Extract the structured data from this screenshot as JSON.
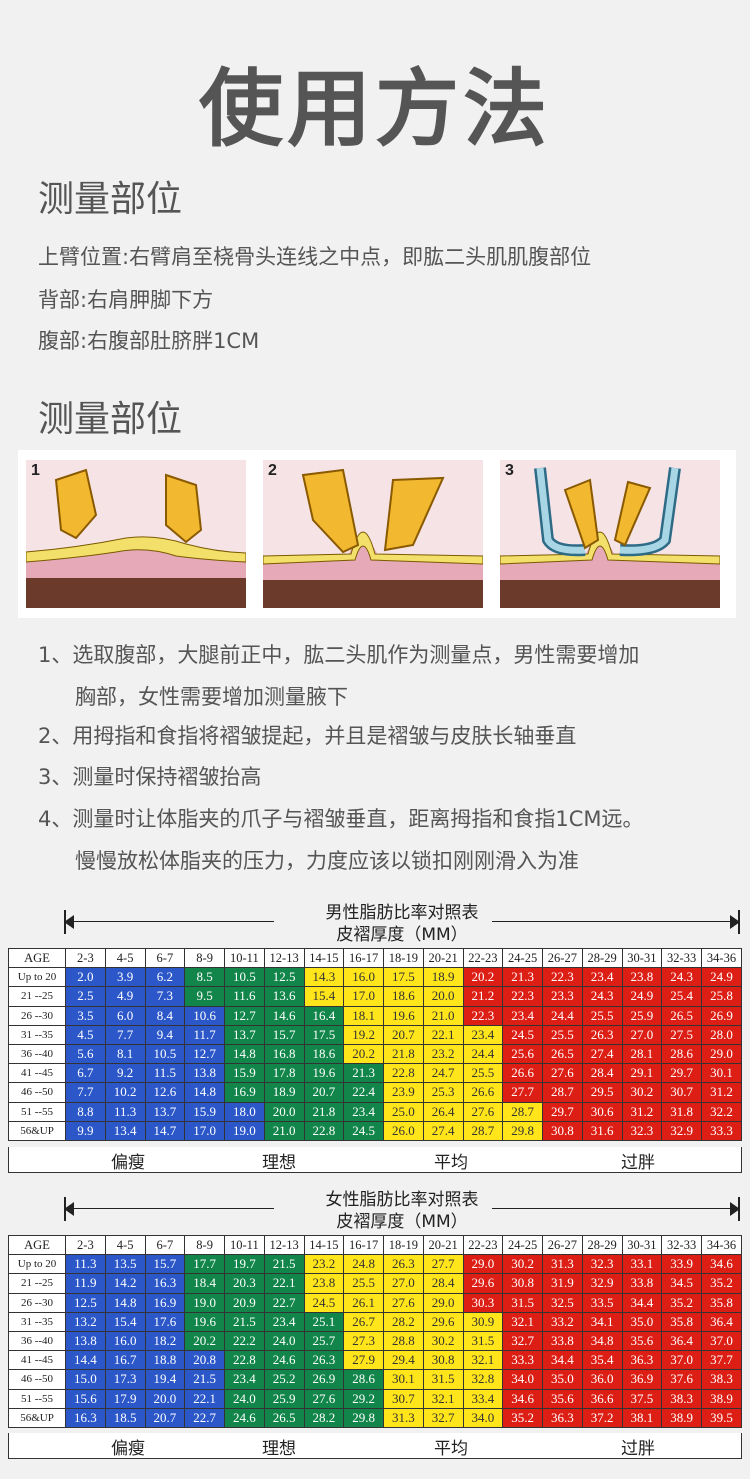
{
  "title": "使用方法",
  "section1": {
    "heading": "测量部位",
    "lines": [
      "上臂位置:右臂肩至桡骨头连线之中点，即肱二头肌肌腹部位",
      "背部:右肩胛脚下方",
      "腹部:右腹部肚脐胖1CM"
    ]
  },
  "section2": {
    "heading": "测量部位",
    "panels": [
      "1",
      "2",
      "3"
    ],
    "steps": [
      {
        "line1": "1、选取腹部，大腿前正中，肱二头肌作为测量点，男性需要增加",
        "line2": "胸部，女性需要增加测量腋下"
      },
      {
        "line1": "2、用拇指和食指将褶皱提起，并且是褶皱与皮肤长轴垂直",
        "line2": ""
      },
      {
        "line1": "3、测量时保持褶皱抬高",
        "line2": ""
      },
      {
        "line1": "4、测量时让体脂夹的爪子与褶皱垂直，距离拇指和食指1CM远。",
        "line2": "慢慢放松体脂夹的压力，力度应该以锁扣刚刚滑入为准"
      }
    ]
  },
  "colors": {
    "blue": "#2b57c9",
    "green": "#12864a",
    "yellow": "#ffe51a",
    "red": "#dc1e14"
  },
  "male_table": {
    "title": "男性脂肪比率对照表",
    "subtitle": "皮褶厚度（MM）",
    "columns": [
      "AGE",
      "2-3",
      "4-5",
      "6-7",
      "8-9",
      "10-11",
      "12-13",
      "14-15",
      "16-17",
      "18-19",
      "20-21",
      "22-23",
      "24-25",
      "26-27",
      "28-29",
      "30-31",
      "32-33",
      "34-36"
    ],
    "rows": [
      [
        "Up to 20",
        "2.0",
        "3.9",
        "6.2",
        "8.5",
        "10.5",
        "12.5",
        "14.3",
        "16.0",
        "17.5",
        "18.9",
        "20.2",
        "21.3",
        "22.3",
        "23.4",
        "23.8",
        "24.3",
        "24.9"
      ],
      [
        "21 --25",
        "2.5",
        "4.9",
        "7.3",
        "9.5",
        "11.6",
        "13.6",
        "15.4",
        "17.0",
        "18.6",
        "20.0",
        "21.2",
        "22.3",
        "23.3",
        "24.3",
        "24.9",
        "25.4",
        "25.8"
      ],
      [
        "26 --30",
        "3.5",
        "6.0",
        "8.4",
        "10.6",
        "12.7",
        "14.6",
        "16.4",
        "18.1",
        "19.6",
        "21.0",
        "22.3",
        "23.4",
        "24.4",
        "25.5",
        "25.9",
        "26.5",
        "26.9"
      ],
      [
        "31 --35",
        "4.5",
        "7.7",
        "9.4",
        "11.7",
        "13.7",
        "15.7",
        "17.5",
        "19.2",
        "20.7",
        "22.1",
        "23.4",
        "24.5",
        "25.5",
        "26.3",
        "27.0",
        "27.5",
        "28.0"
      ],
      [
        "36 --40",
        "5.6",
        "8.1",
        "10.5",
        "12.7",
        "14.8",
        "16.8",
        "18.6",
        "20.2",
        "21.8",
        "23.2",
        "24.4",
        "25.6",
        "26.5",
        "27.4",
        "28.1",
        "28.6",
        "29.0"
      ],
      [
        "41 --45",
        "6.7",
        "9.2",
        "11.5",
        "13.8",
        "15.9",
        "17.8",
        "19.6",
        "21.3",
        "22.8",
        "24.7",
        "25.5",
        "26.6",
        "27.6",
        "28.4",
        "29.1",
        "29.7",
        "30.1"
      ],
      [
        "46 --50",
        "7.7",
        "10.2",
        "12.6",
        "14.8",
        "16.9",
        "18.9",
        "20.7",
        "22.4",
        "23.9",
        "25.3",
        "26.6",
        "27.7",
        "28.7",
        "29.5",
        "30.2",
        "30.7",
        "31.2"
      ],
      [
        "51 --55",
        "8.8",
        "11.3",
        "13.7",
        "15.9",
        "18.0",
        "20.0",
        "21.8",
        "23.4",
        "25.0",
        "26.4",
        "27.6",
        "28.7",
        "29.7",
        "30.6",
        "31.2",
        "31.8",
        "32.2"
      ],
      [
        "56&UP",
        "9.9",
        "13.4",
        "14.7",
        "17.0",
        "19.0",
        "21.0",
        "22.8",
        "24.5",
        "26.0",
        "27.4",
        "28.7",
        "29.8",
        "30.8",
        "31.6",
        "32.3",
        "32.9",
        "33.3"
      ]
    ],
    "green_start": [
      4,
      4,
      5,
      5,
      5,
      5,
      5,
      6,
      6
    ],
    "yellow_start": [
      7,
      7,
      8,
      8,
      8,
      9,
      9,
      9,
      9
    ],
    "red_start": [
      11,
      11,
      11,
      12,
      12,
      12,
      12,
      13,
      13
    ],
    "categories": [
      "偏瘦",
      "理想",
      "平均",
      "过胖"
    ]
  },
  "female_table": {
    "title": "女性脂肪比率对照表",
    "subtitle": "皮褶厚度（MM）",
    "columns": [
      "AGE",
      "2-3",
      "4-5",
      "6-7",
      "8-9",
      "10-11",
      "12-13",
      "14-15",
      "16-17",
      "18-19",
      "20-21",
      "22-23",
      "24-25",
      "26-27",
      "28-29",
      "30-31",
      "32-33",
      "34-36"
    ],
    "rows": [
      [
        "Up to 20",
        "11.3",
        "13.5",
        "15.7",
        "17.7",
        "19.7",
        "21.5",
        "23.2",
        "24.8",
        "26.3",
        "27.7",
        "29.0",
        "30.2",
        "31.3",
        "32.3",
        "33.1",
        "33.9",
        "34.6"
      ],
      [
        "21 --25",
        "11.9",
        "14.2",
        "16.3",
        "18.4",
        "20.3",
        "22.1",
        "23.8",
        "25.5",
        "27.0",
        "28.4",
        "29.6",
        "30.8",
        "31.9",
        "32.9",
        "33.8",
        "34.5",
        "35.2"
      ],
      [
        "26 --30",
        "12.5",
        "14.8",
        "16.9",
        "19.0",
        "20.9",
        "22.7",
        "24.5",
        "26.1",
        "27.6",
        "29.0",
        "30.3",
        "31.5",
        "32.5",
        "33.5",
        "34.4",
        "35.2",
        "35.8"
      ],
      [
        "31 --35",
        "13.2",
        "15.4",
        "17.6",
        "19.6",
        "21.5",
        "23.4",
        "25.1",
        "26.7",
        "28.2",
        "29.6",
        "30.9",
        "32.1",
        "33.2",
        "34.1",
        "35.0",
        "35.8",
        "36.4"
      ],
      [
        "36 --40",
        "13.8",
        "16.0",
        "18.2",
        "20.2",
        "22.2",
        "24.0",
        "25.7",
        "27.3",
        "28.8",
        "30.2",
        "31.5",
        "32.7",
        "33.8",
        "34.8",
        "35.6",
        "36.4",
        "37.0"
      ],
      [
        "41 --45",
        "14.4",
        "16.7",
        "18.8",
        "20.8",
        "22.8",
        "24.6",
        "26.3",
        "27.9",
        "29.4",
        "30.8",
        "32.1",
        "33.3",
        "34.4",
        "35.4",
        "36.3",
        "37.0",
        "37.7"
      ],
      [
        "46 --50",
        "15.0",
        "17.3",
        "19.4",
        "21.5",
        "23.4",
        "25.2",
        "26.9",
        "28.6",
        "30.1",
        "31.5",
        "32.8",
        "34.0",
        "35.0",
        "36.0",
        "36.9",
        "37.6",
        "38.3"
      ],
      [
        "51 --55",
        "15.6",
        "17.9",
        "20.0",
        "22.1",
        "24.0",
        "25.9",
        "27.6",
        "29.2",
        "30.7",
        "32.1",
        "33.4",
        "34.6",
        "35.6",
        "36.6",
        "37.5",
        "38.3",
        "38.9"
      ],
      [
        "56&UP",
        "16.3",
        "18.5",
        "20.7",
        "22.7",
        "24.6",
        "26.5",
        "28.2",
        "29.8",
        "31.3",
        "32.7",
        "34.0",
        "35.2",
        "36.3",
        "37.2",
        "38.1",
        "38.9",
        "39.5"
      ]
    ],
    "green_start": [
      4,
      4,
      4,
      4,
      4,
      5,
      5,
      5,
      5
    ],
    "yellow_start": [
      7,
      7,
      7,
      8,
      8,
      8,
      9,
      9,
      9
    ],
    "red_start": [
      11,
      11,
      11,
      12,
      12,
      12,
      12,
      12,
      12
    ],
    "categories": [
      "偏瘦",
      "理想",
      "平均",
      "过胖"
    ]
  }
}
